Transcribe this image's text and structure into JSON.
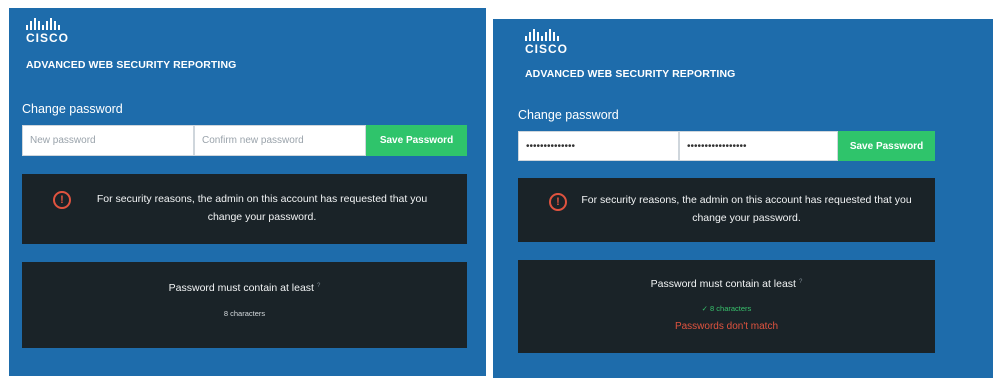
{
  "left": {
    "logo_text": "CISCO",
    "product_title": "ADVANCED WEB SECURITY REPORTING",
    "section_label": "Change password",
    "new_password_placeholder": "New password",
    "confirm_password_placeholder": "Confirm new password",
    "save_button_label": "Save Password",
    "alert_icon_glyph": "!",
    "alert_text": "For security reasons, the admin on this account has requested that you change your password.",
    "requirements_title": "Password must contain at least",
    "requirements_sup": "?",
    "requirement_item": "8 characters"
  },
  "right": {
    "logo_text": "CISCO",
    "product_title": "ADVANCED WEB SECURITY REPORTING",
    "section_label": "Change password",
    "new_password_value": "••••••••••••••",
    "confirm_password_value": "•••••••••••••••••",
    "save_button_label": "Save Password",
    "alert_icon_glyph": "!",
    "alert_text": "For security reasons, the admin on this account has requested that you change your password.",
    "requirements_title": "Password must contain at least",
    "requirements_sup": "?",
    "requirement_item": "✓ 8 characters",
    "mismatch_text": "Passwords don't match"
  },
  "colors": {
    "panel_bg": "#1e6cab",
    "dark_box": "#1a2328",
    "save_button": "#2fc46b",
    "alert_red": "#e0533f",
    "ok_green": "#38c16c"
  },
  "icons": {
    "logo": "cisco-bars-icon",
    "alert": "exclamation-circle-icon",
    "check": "check-icon"
  }
}
